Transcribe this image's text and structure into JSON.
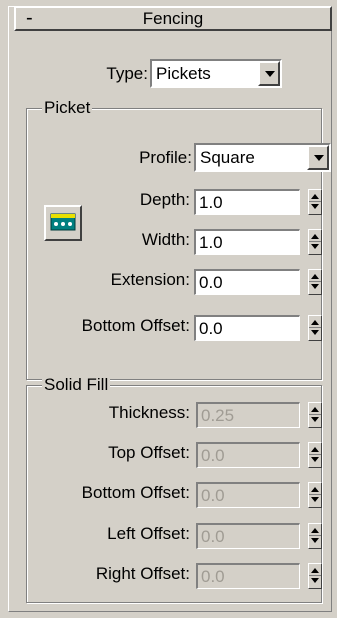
{
  "rollout": {
    "collapse_symbol": "-",
    "title": "Fencing"
  },
  "type": {
    "label": "Type:",
    "value": "Pickets"
  },
  "picket": {
    "group_title": "Picket",
    "profile": {
      "label": "Profile:",
      "value": "Square"
    },
    "depth": {
      "label": "Depth:",
      "value": "1.0"
    },
    "width": {
      "label": "Width:",
      "value": "1.0"
    },
    "extension": {
      "label": "Extension:",
      "value": "0.0"
    },
    "bottom_offset": {
      "label": "Bottom Offset:",
      "value": "0.0"
    }
  },
  "solid_fill": {
    "group_title": "Solid Fill",
    "thickness": {
      "label": "Thickness:",
      "value": "0.25"
    },
    "top_offset": {
      "label": "Top Offset:",
      "value": "0.0"
    },
    "bottom_offset": {
      "label": "Bottom Offset:",
      "value": "0.0"
    },
    "left_offset": {
      "label": "Left Offset:",
      "value": "0.0"
    },
    "right_offset": {
      "label": "Right Offset:",
      "value": "0.0"
    }
  },
  "icons": {
    "picket_button": "picket-pick-icon"
  },
  "colors": {
    "panel_bg": "#d4d0c8",
    "field_bg": "#ffffff",
    "disabled_text": "#a09c94",
    "icon_teal": "#008080",
    "icon_yellow": "#e8e000"
  }
}
